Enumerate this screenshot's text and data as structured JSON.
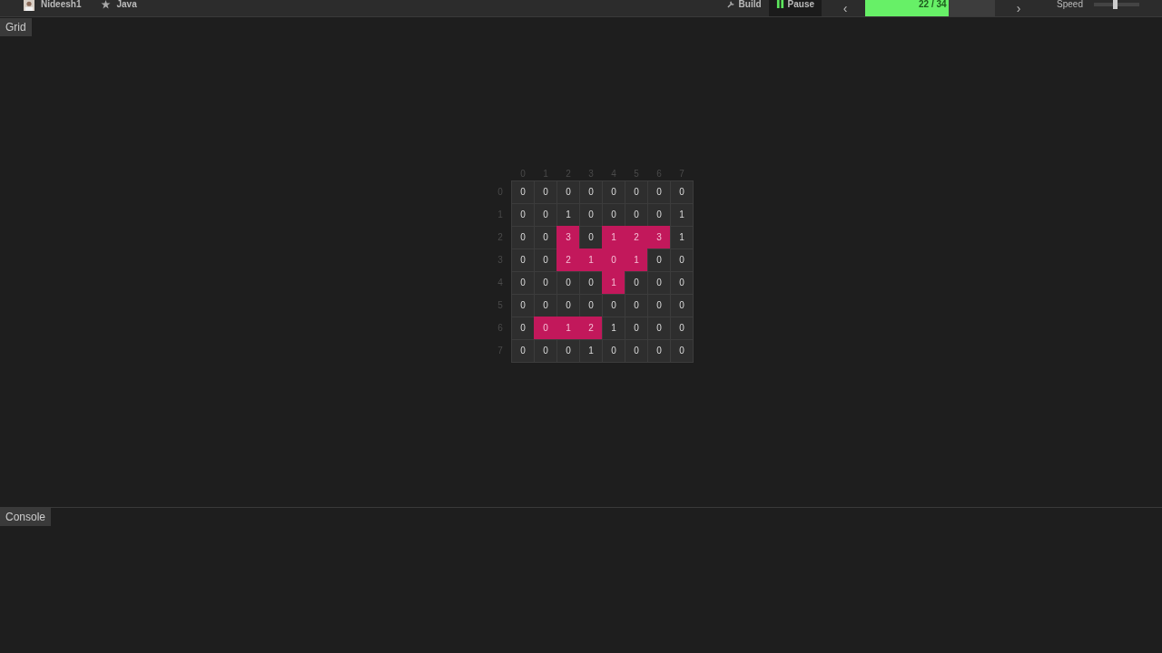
{
  "toolbar": {
    "user": "Nideesh1",
    "language": "Java",
    "build": "Build",
    "pause": "Pause",
    "prev": "‹",
    "progress": {
      "text": "22 / 34",
      "level": 0.64
    },
    "next": "›",
    "speed": {
      "label": "Speed",
      "level": 0.46
    }
  },
  "grid_panel": {
    "title": "Grid",
    "col_headers": [
      "0",
      "1",
      "2",
      "3",
      "4",
      "5",
      "6",
      "7"
    ],
    "row_headers": [
      "0",
      "1",
      "2",
      "3",
      "4",
      "5",
      "6",
      "7"
    ],
    "rows": [
      [
        {
          "value": "0",
          "highlighted": false
        },
        {
          "value": "0",
          "highlighted": false
        },
        {
          "value": "0",
          "highlighted": false
        },
        {
          "value": "0",
          "highlighted": false
        },
        {
          "value": "0",
          "highlighted": false
        },
        {
          "value": "0",
          "highlighted": false
        },
        {
          "value": "0",
          "highlighted": false
        },
        {
          "value": "0",
          "highlighted": false
        }
      ],
      [
        {
          "value": "0",
          "highlighted": false
        },
        {
          "value": "0",
          "highlighted": false
        },
        {
          "value": "1",
          "highlighted": false
        },
        {
          "value": "0",
          "highlighted": false
        },
        {
          "value": "0",
          "highlighted": false
        },
        {
          "value": "0",
          "highlighted": false
        },
        {
          "value": "0",
          "highlighted": false
        },
        {
          "value": "1",
          "highlighted": false
        }
      ],
      [
        {
          "value": "0",
          "highlighted": false
        },
        {
          "value": "0",
          "highlighted": false
        },
        {
          "value": "3",
          "highlighted": true
        },
        {
          "value": "0",
          "highlighted": false
        },
        {
          "value": "1",
          "highlighted": true
        },
        {
          "value": "2",
          "highlighted": true
        },
        {
          "value": "3",
          "highlighted": true
        },
        {
          "value": "1",
          "highlighted": false
        }
      ],
      [
        {
          "value": "0",
          "highlighted": false
        },
        {
          "value": "0",
          "highlighted": false
        },
        {
          "value": "2",
          "highlighted": true
        },
        {
          "value": "1",
          "highlighted": true
        },
        {
          "value": "0",
          "highlighted": true
        },
        {
          "value": "1",
          "highlighted": true
        },
        {
          "value": "0",
          "highlighted": false
        },
        {
          "value": "0",
          "highlighted": false
        }
      ],
      [
        {
          "value": "0",
          "highlighted": false
        },
        {
          "value": "0",
          "highlighted": false
        },
        {
          "value": "0",
          "highlighted": false
        },
        {
          "value": "0",
          "highlighted": false
        },
        {
          "value": "1",
          "highlighted": true
        },
        {
          "value": "0",
          "highlighted": false
        },
        {
          "value": "0",
          "highlighted": false
        },
        {
          "value": "0",
          "highlighted": false
        }
      ],
      [
        {
          "value": "0",
          "highlighted": false
        },
        {
          "value": "0",
          "highlighted": false
        },
        {
          "value": "0",
          "highlighted": false
        },
        {
          "value": "0",
          "highlighted": false
        },
        {
          "value": "0",
          "highlighted": false
        },
        {
          "value": "0",
          "highlighted": false
        },
        {
          "value": "0",
          "highlighted": false
        },
        {
          "value": "0",
          "highlighted": false
        }
      ],
      [
        {
          "value": "0",
          "highlighted": false
        },
        {
          "value": "0",
          "highlighted": true
        },
        {
          "value": "1",
          "highlighted": true
        },
        {
          "value": "2",
          "highlighted": true
        },
        {
          "value": "1",
          "highlighted": false
        },
        {
          "value": "0",
          "highlighted": false
        },
        {
          "value": "0",
          "highlighted": false
        },
        {
          "value": "0",
          "highlighted": false
        }
      ],
      [
        {
          "value": "0",
          "highlighted": false
        },
        {
          "value": "0",
          "highlighted": false
        },
        {
          "value": "0",
          "highlighted": false
        },
        {
          "value": "1",
          "highlighted": false
        },
        {
          "value": "0",
          "highlighted": false
        },
        {
          "value": "0",
          "highlighted": false
        },
        {
          "value": "0",
          "highlighted": false
        },
        {
          "value": "0",
          "highlighted": false
        }
      ]
    ]
  },
  "console_panel": {
    "title": "Console"
  }
}
